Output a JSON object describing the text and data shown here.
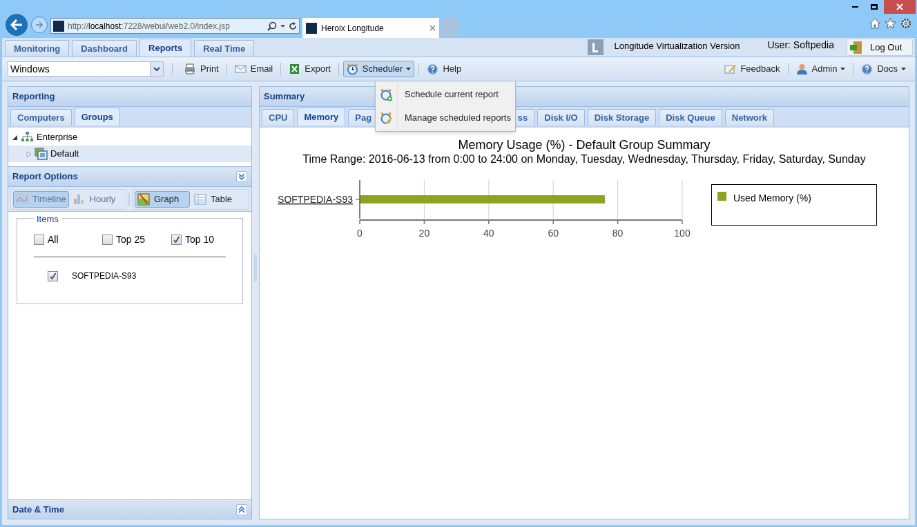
{
  "browser": {
    "address": {
      "scheme": "http://",
      "host": "localhost",
      "path": ":7228/webui/web2.0/index.jsp"
    },
    "tab_title": "Heroix Longitude"
  },
  "app_tabs": [
    {
      "label": "Monitoring",
      "selected": false
    },
    {
      "label": "Dashboard",
      "selected": false
    },
    {
      "label": "Reports",
      "selected": true
    },
    {
      "label": "Real Time",
      "selected": false
    }
  ],
  "header": {
    "product": "Longitude Virtualization Version",
    "user": "User: Softpedia",
    "logout": "Log Out"
  },
  "toolbar": {
    "select_value": "Windows",
    "left_buttons": [
      {
        "label": "Print",
        "kind": "print",
        "expanded": false,
        "dropdown": false
      },
      {
        "label": "Email",
        "kind": "email",
        "expanded": false,
        "dropdown": false
      },
      {
        "label": "Export",
        "kind": "export",
        "expanded": false,
        "dropdown": false
      },
      {
        "label": "Scheduler",
        "kind": "clock",
        "expanded": true,
        "dropdown": true
      },
      {
        "label": "Help",
        "kind": "help",
        "expanded": false,
        "dropdown": false
      }
    ],
    "right_buttons": [
      {
        "label": "Feedback",
        "kind": "feedback",
        "expanded": false,
        "dropdown": false
      },
      {
        "label": "Admin",
        "kind": "user",
        "expanded": false,
        "dropdown": true
      },
      {
        "label": "Docs",
        "kind": "help",
        "expanded": false,
        "dropdown": true
      }
    ]
  },
  "scheduler_menu": [
    {
      "label": "Schedule current report",
      "kind": "add"
    },
    {
      "label": "Manage scheduled reports",
      "kind": "edit"
    }
  ],
  "reporting": {
    "title": "Reporting",
    "tabs": [
      {
        "label": "Computers",
        "selected": false
      },
      {
        "label": "Groups",
        "selected": true
      }
    ],
    "tree": [
      {
        "label": "Enterprise",
        "kind": "network",
        "expanded": true,
        "selected": false,
        "children": [
          {
            "label": "Default",
            "kind": "group",
            "expanded": false,
            "selected": true
          }
        ]
      }
    ]
  },
  "report_options": {
    "title": "Report Options",
    "view_buttons": [
      {
        "label": "Timeline",
        "kind": "timeline",
        "selected": true,
        "disabled": true
      },
      {
        "label": "Hourly",
        "kind": "hourly",
        "selected": false,
        "disabled": true
      },
      {
        "label": "Graph",
        "kind": "graph",
        "selected": true,
        "disabled": false
      },
      {
        "label": "Table",
        "kind": "table",
        "selected": false,
        "disabled": false
      }
    ],
    "items_legend": "Items",
    "filters": [
      {
        "label": "All",
        "checked": false
      },
      {
        "label": "Top 25",
        "checked": false
      },
      {
        "label": "Top 10",
        "checked": true
      }
    ],
    "items": [
      {
        "label": "SOFTPEDIA-S93",
        "checked": true
      }
    ]
  },
  "date_time": {
    "title": "Date & Time"
  },
  "summary": {
    "title": "Summary",
    "tabs": [
      {
        "label": "CPU",
        "selected": false
      },
      {
        "label": "Memory",
        "selected": true
      },
      {
        "label": "Pag",
        "selected": false
      },
      {
        "label": "ss",
        "selected": false
      },
      {
        "label": "Disk I/O",
        "selected": false
      },
      {
        "label": "Disk Storage",
        "selected": false
      },
      {
        "label": "Disk Queue",
        "selected": false
      },
      {
        "label": "Network",
        "selected": false
      }
    ],
    "time_range": "Time Range: 2016-06-13 from 0:00 to 24:00 on Monday, Tuesday, Wednesday, Thursday, Friday, Saturday, Sunday",
    "chart_data": {
      "type": "bar",
      "orientation": "horizontal",
      "title": "Memory Usage (%) - Default Group Summary",
      "categories": [
        "SOFTPEDIA-S93"
      ],
      "series": [
        {
          "name": "Used Memory (%)",
          "color": "#8fa31f",
          "values": [
            76
          ]
        }
      ],
      "grid": true,
      "xlim": [
        0,
        100
      ],
      "xticks": [
        0,
        20,
        40,
        60,
        80,
        100
      ]
    }
  }
}
